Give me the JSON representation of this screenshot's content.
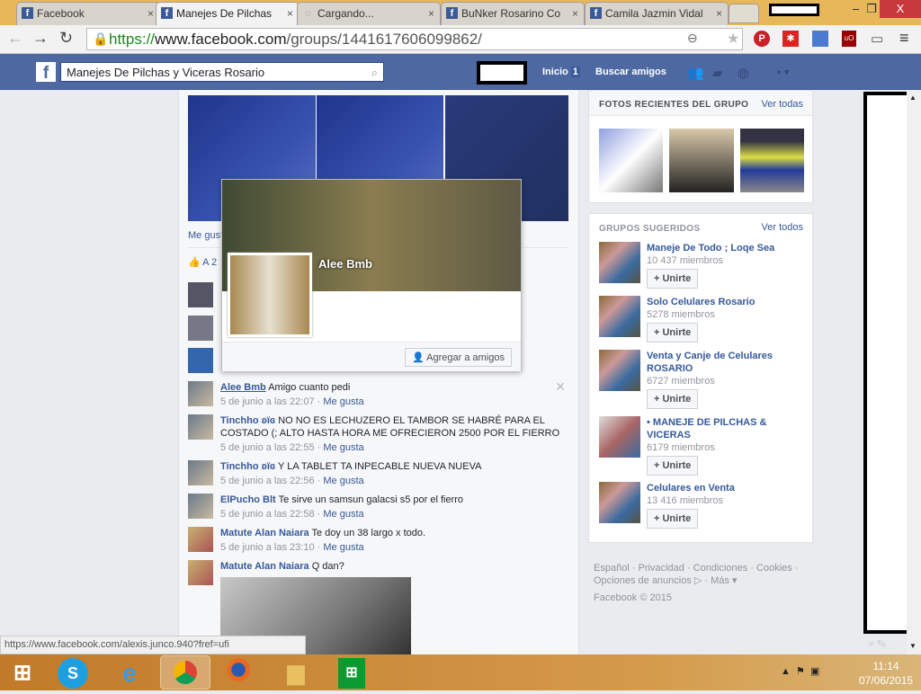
{
  "browser": {
    "tabs": [
      {
        "title": "Facebook"
      },
      {
        "title": "Manejes De Pilchas"
      },
      {
        "title": "Cargando..."
      },
      {
        "title": "BuNker Rosarino Co"
      },
      {
        "title": "Camila Jazmin Vidal"
      }
    ],
    "url_scheme": "https://",
    "url_host": "www.facebook.com",
    "url_path": "/groups/1441617606099862/",
    "status_url": "https://www.facebook.com/alexis.junco.940?fref=ufi"
  },
  "fb": {
    "search_value": "Manejes De Pilchas y Viceras Rosario",
    "nav": {
      "home": "Inicio",
      "home_count": "1",
      "find_friends": "Buscar amigos"
    }
  },
  "post": {
    "like_link": "Me gust",
    "likes_text": "A 2"
  },
  "popup": {
    "name": "Alee Bmb",
    "add_friend": "Agregar a amigos"
  },
  "comments": [
    {
      "author": "Alee Bmb",
      "text": "Amigo cuanto pedi",
      "time": "5 de junio a las 22:07",
      "like": "Me gusta"
    },
    {
      "author": "Tinchho ʚïɞ",
      "text": "NO NO ES LECHUZERO EL TAMBOR SE HABRÉ PARA EL COSTADO (; ALTO HASTA HORA ME OFRECIERON 2500 POR EL FIERRO",
      "time": "5 de junio a las 22:55",
      "like": "Me gusta"
    },
    {
      "author": "Tinchho ʚïɞ",
      "text": "Y LA TABLET TA INPECABLE NUEVA NUEVA",
      "time": "5 de junio a las 22:56",
      "like": "Me gusta"
    },
    {
      "author": "ElPucho Blt",
      "text": "Te sirve un samsun galacsi s5 por el fierro",
      "time": "5 de junio a las 22:58",
      "like": "Me gusta"
    },
    {
      "author": "Matute Alan Naiara",
      "text": "Te doy un 38 largo x todo.",
      "time": "5 de junio a las 23:10",
      "like": "Me gusta"
    },
    {
      "author": "Matute Alan Naiara",
      "text": "Q dan?"
    }
  ],
  "sidebar": {
    "photos_title": "FOTOS RECIENTES DEL GRUPO",
    "photos_link": "Ver todas",
    "groups_title": "GRUPOS SUGERIDOS",
    "groups_link": "Ver todos",
    "join_label": "+ Unirte",
    "groups": [
      {
        "name": "Maneje De Todo ; Loqe Sea",
        "members": "10 437 miembros"
      },
      {
        "name": "Solo Celulares Rosario",
        "members": "5278 miembros"
      },
      {
        "name": "Venta y Canje de Celulares ROSARIO",
        "members": "6727 miembros"
      },
      {
        "name": "• MANEJE DE PILCHAS & VICERAS",
        "members": "6179 miembros"
      },
      {
        "name": "Celulares en Venta",
        "members": "13 416 miembros"
      }
    ],
    "footer": {
      "line1": "Español · Privacidad · Condiciones · Cookies ·",
      "line2": "Opciones de anuncios ▷ · Más ▾",
      "copyright": "Facebook © 2015"
    }
  },
  "taskbar": {
    "time": "11:14",
    "date": "07/06/2015"
  },
  "colors": {
    "fb_blue": "#4e69a2",
    "link": "#365899",
    "taskbar": "#c07a2a"
  }
}
